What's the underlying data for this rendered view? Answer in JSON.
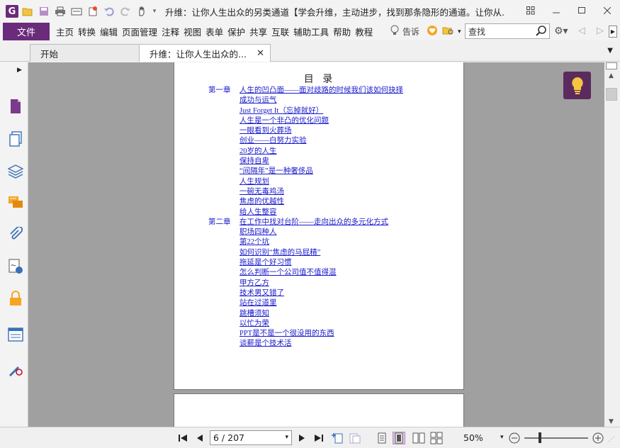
{
  "titlebar": {
    "window_title": "升维：让你人生出众的另类通道【学会升维，主动进步，找到那条隐形的通道。让你从...",
    "quick_access": [
      "app-logo-icon",
      "open-folder-icon",
      "save-icon",
      "print-icon",
      "scan-icon",
      "new-icon",
      "undo-icon",
      "redo-icon",
      "hand-tool-icon"
    ]
  },
  "menu": {
    "file": "文件",
    "items": [
      "主页",
      "转换",
      "编辑",
      "页面管理",
      "注释",
      "视图",
      "表单",
      "保护",
      "共享",
      "互联",
      "辅助工具",
      "帮助",
      "教程"
    ],
    "tell_me": "告诉",
    "search_placeholder": "查找"
  },
  "tabs": [
    {
      "label": "开始",
      "active": false
    },
    {
      "label": "升维：让你人生出众的...",
      "active": true
    }
  ],
  "left_panel_icons": [
    "page-thumbnail-icon",
    "pages-icon",
    "layers-icon",
    "comments-icon",
    "attachments-icon",
    "signature-icon",
    "security-icon",
    "form-fields-icon",
    "tools-icon"
  ],
  "document": {
    "toc_title": "目 录",
    "entries": [
      {
        "chapter": "第一章",
        "text": "人生的凹凸面——面对歧路的时候我们该如何抉择"
      },
      {
        "chapter": "",
        "text": "成功与运气"
      },
      {
        "chapter": "",
        "text": "Just Forget It（忘掉就好）"
      },
      {
        "chapter": "",
        "text": "人生是一个非凸的优化问题"
      },
      {
        "chapter": "",
        "text": "一眼看到火葬场"
      },
      {
        "chapter": "",
        "text": "创业——白努力实验"
      },
      {
        "chapter": "",
        "text": "20岁的人生"
      },
      {
        "chapter": "",
        "text": "保持自卑"
      },
      {
        "chapter": "",
        "text": "“间隔年”是一种奢侈品"
      },
      {
        "chapter": "",
        "text": "人生规划"
      },
      {
        "chapter": "",
        "text": "一碗无毒鸡汤"
      },
      {
        "chapter": "",
        "text": "焦虑的优越性"
      },
      {
        "chapter": "",
        "text": "给人生整容"
      },
      {
        "chapter": "第二章",
        "text": "在工作中找对台阶——走向出众的多元化方式"
      },
      {
        "chapter": "",
        "text": "职场四种人"
      },
      {
        "chapter": "",
        "text": "第22个坑"
      },
      {
        "chapter": "",
        "text": "如何识别“焦虑的马屁精”"
      },
      {
        "chapter": "",
        "text": "拖延是个好习惯"
      },
      {
        "chapter": "",
        "text": "怎么判断一个公司值不值得混"
      },
      {
        "chapter": "",
        "text": "甲方乙方"
      },
      {
        "chapter": "",
        "text": "技术男又错了"
      },
      {
        "chapter": "",
        "text": "站在过道里"
      },
      {
        "chapter": "",
        "text": "跳槽须知"
      },
      {
        "chapter": "",
        "text": "以忙为荣"
      },
      {
        "chapter": "",
        "text": "PPT是不是一个很没用的东西"
      },
      {
        "chapter": "",
        "text": "谈薪是个技术活"
      }
    ]
  },
  "status": {
    "page_indicator": "6 / 207",
    "zoom": "50%"
  },
  "colors": {
    "brand": "#6a2b7a",
    "link": "#1a1acc",
    "doc_bg": "#a0a0a0"
  }
}
